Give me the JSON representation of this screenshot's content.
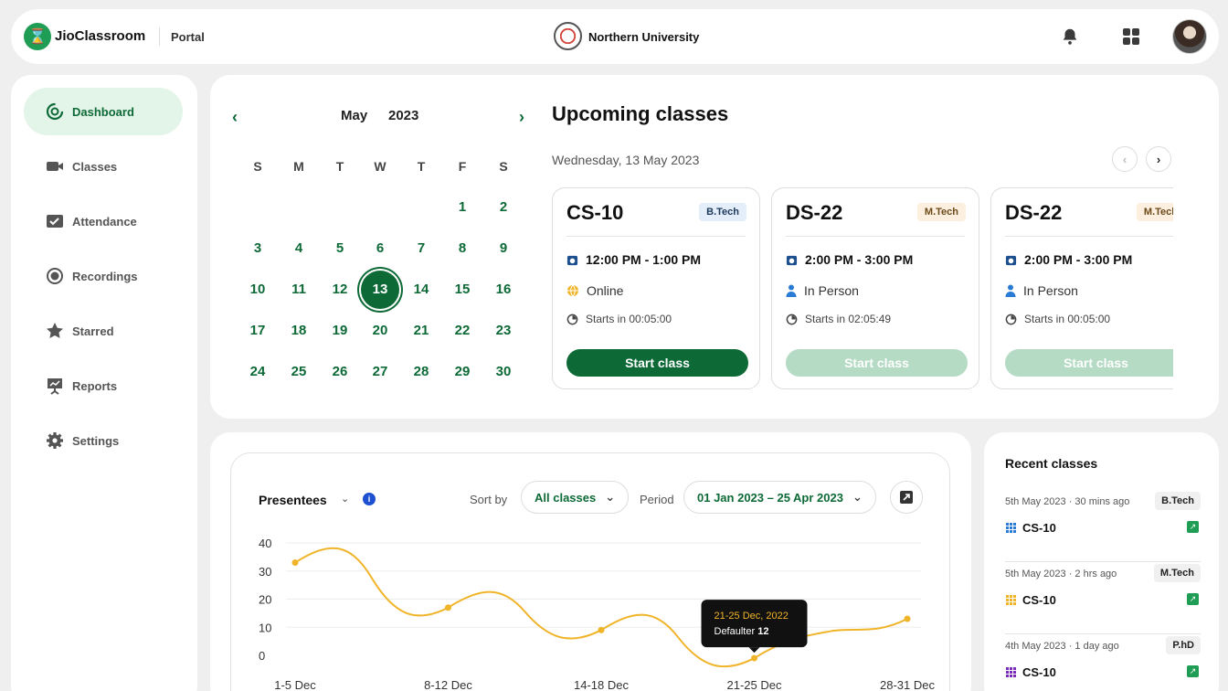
{
  "header": {
    "brand": "JioClassroom",
    "portal": "Portal",
    "university": "Northern University",
    "icons": [
      "bell-icon",
      "grid-icon"
    ]
  },
  "sidebar": {
    "items": [
      {
        "label": "Dashboard",
        "icon": "dashboard-icon",
        "active": true
      },
      {
        "label": "Classes",
        "icon": "video-icon"
      },
      {
        "label": "Attendance",
        "icon": "attendance-icon"
      },
      {
        "label": "Recordings",
        "icon": "record-icon"
      },
      {
        "label": "Starred",
        "icon": "star-icon"
      },
      {
        "label": "Reports",
        "icon": "reports-icon"
      },
      {
        "label": "Settings",
        "icon": "gear-icon"
      }
    ]
  },
  "calendar": {
    "month": "May",
    "year": "2023",
    "weekdays": [
      "S",
      "M",
      "T",
      "W",
      "T",
      "F",
      "S"
    ],
    "first_weekday_index": 5,
    "days_in_month": 30,
    "selected_day": 13
  },
  "upcoming": {
    "title": "Upcoming classes",
    "date": "Wednesday, 13 May 2023",
    "cards": [
      {
        "code": "CS-10",
        "badge": "B.Tech",
        "time": "12:00 PM - 1:00 PM",
        "mode": "Online",
        "starts": "Starts in 00:05:00",
        "button": "Start class",
        "enabled": true
      },
      {
        "code": "DS-22",
        "badge": "M.Tech",
        "time": "2:00 PM - 3:00 PM",
        "mode": "In Person",
        "starts": "Starts in 02:05:49",
        "button": "Start class",
        "enabled": false
      },
      {
        "code": "DS-22",
        "badge": "M.Tech",
        "time": "2:00 PM - 3:00 PM",
        "mode": "In Person",
        "starts": "Starts in 00:05:00",
        "button": "Start class",
        "enabled": false
      }
    ]
  },
  "presentees": {
    "title": "Presentees",
    "sort_label": "Sort by",
    "sort_value": "All classes",
    "period_label": "Period",
    "period_value": "01 Jan 2023 – 25 Apr 2023"
  },
  "chart_data": {
    "type": "line",
    "categories": [
      "1-5 Dec",
      "8-12 Dec",
      "14-18 Dec",
      "21-25 Dec",
      "28-31 Dec"
    ],
    "series": [
      {
        "values": [
          33,
          17,
          9,
          -1,
          13
        ]
      }
    ],
    "ylim": [
      0,
      40
    ],
    "yticks": [
      0,
      10,
      20,
      30,
      40
    ],
    "grid": true,
    "line_color": "#f0b429",
    "tooltip": {
      "title": "21-25 Dec, 2022",
      "label": "Defaulter",
      "value": "12"
    }
  },
  "recent": {
    "title": "Recent classes",
    "items": [
      {
        "meta": "5th May 2023 · 30 mins ago",
        "badge": "B.Tech",
        "code": "CS-10",
        "color": "#2a7bd6"
      },
      {
        "meta": "5th May 2023 · 2 hrs ago",
        "badge": "M.Tech",
        "code": "CS-10",
        "color": "#f0b429"
      },
      {
        "meta": "4th May 2023 · 1 day ago",
        "badge": "P.hD",
        "code": "CS-10",
        "color": "#7a2bb8"
      }
    ]
  },
  "colors": {
    "brand_green": "#0d6a37",
    "accent_light": "#e3f4e9"
  }
}
